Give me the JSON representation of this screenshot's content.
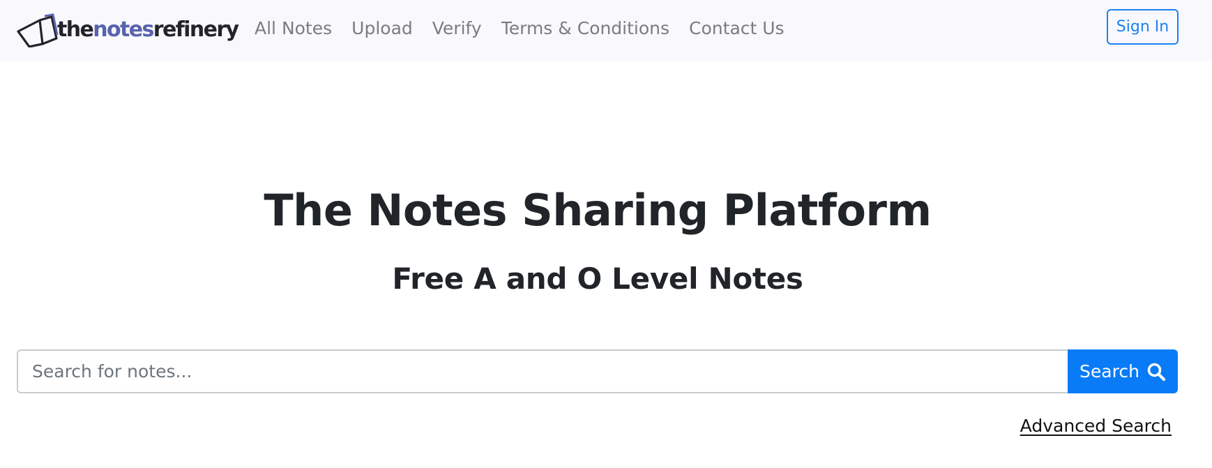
{
  "header": {
    "brand": {
      "part1": "the",
      "part2": "notes",
      "part3": "refinery",
      "icon": "book-logo-icon",
      "colors": {
        "dark": "#23232b",
        "accent": "#5963ad"
      }
    },
    "nav": [
      {
        "label": "All Notes"
      },
      {
        "label": "Upload"
      },
      {
        "label": "Verify"
      },
      {
        "label": "Terms & Conditions"
      },
      {
        "label": "Contact Us"
      }
    ],
    "signin_label": "Sign In"
  },
  "hero": {
    "title": "The Notes Sharing Platform",
    "subtitle": "Free A and O Level Notes"
  },
  "search": {
    "placeholder": "Search for notes...",
    "value": "",
    "button_label": "Search",
    "button_icon": "search-icon",
    "advanced_label": "Advanced Search"
  },
  "colors": {
    "primary": "#0a7bf6",
    "navbar_bg": "#f8f8fd",
    "nav_text": "#7c7c80"
  }
}
